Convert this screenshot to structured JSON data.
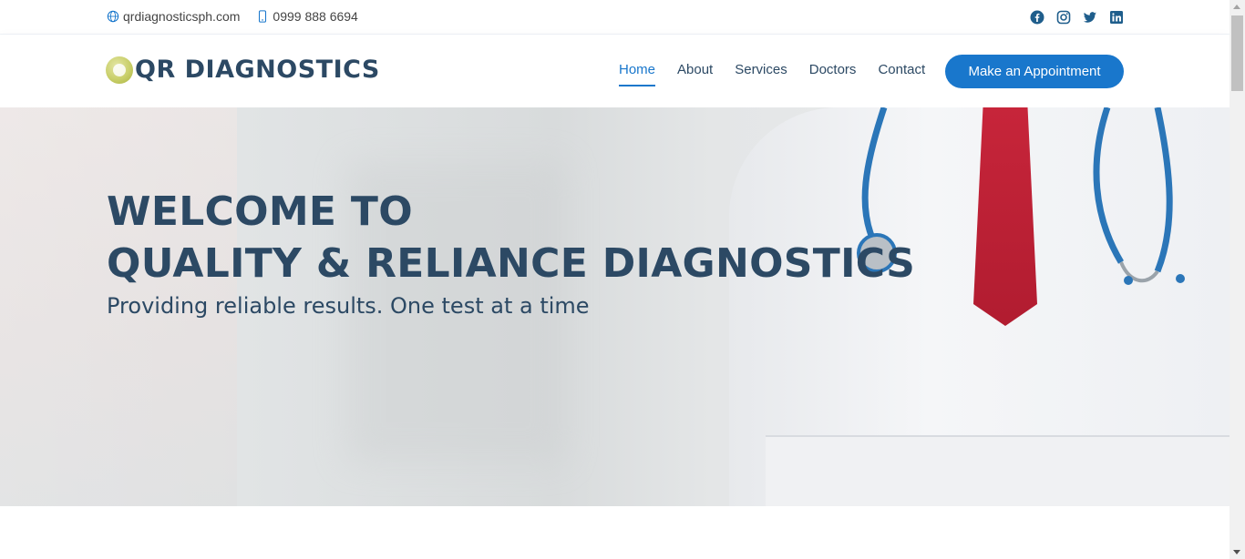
{
  "topbar": {
    "email_text": "qrdiagnosticsph.com",
    "phone_text": "0999 888 6694",
    "social_icons": [
      "facebook-icon",
      "instagram-icon",
      "twitter-icon",
      "linkedin-icon"
    ]
  },
  "header": {
    "logo_text": "QR DIAGNOSTICS",
    "nav": [
      {
        "label": "Home",
        "active": true
      },
      {
        "label": "About"
      },
      {
        "label": "Services"
      },
      {
        "label": "Doctors"
      },
      {
        "label": "Contact"
      }
    ],
    "cta_label": "Make an Appointment"
  },
  "hero": {
    "title_line1": "WELCOME TO",
    "title_line2": "QUALITY & RELIANCE DIAGNOSTICS",
    "tagline": "Providing reliable results. One test at a time"
  },
  "colors": {
    "primary": "#1977cc",
    "heading": "#2c4964",
    "tie": "#c7253a"
  }
}
